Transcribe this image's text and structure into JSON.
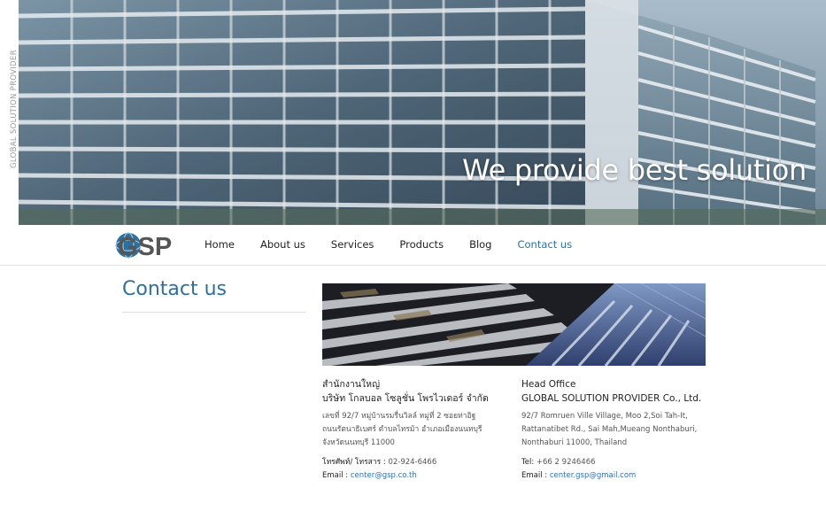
{
  "side_label": "GLOBAL SOLUTION PROVIDER",
  "hero": {
    "tagline": "We provide best solution"
  },
  "logo": {
    "text": "GSP"
  },
  "nav": {
    "items": [
      {
        "label": "Home"
      },
      {
        "label": "About us"
      },
      {
        "label": "Services"
      },
      {
        "label": "Products"
      },
      {
        "label": "Blog"
      },
      {
        "label": "Contact us",
        "active": true
      }
    ]
  },
  "page": {
    "title": "Contact us"
  },
  "thai_office": {
    "heading": "สำนักงานใหญ่",
    "company": "บริษัท โกลบอล โซลูชั่น โพรไวเดอร์ จำกัด",
    "address_line1": "เลขที่ 92/7 หมู่บ้านรมรื่นวิลล์ หมู่ที่ 2 ซอยท่าอิฐ",
    "address_line2": "ถนนรัตนาธิเบศร์ ตำบลไทรม้า อำเภอเมืองนนทบุรี",
    "address_line3": "จังหวัดนนทบุรี 11000",
    "phone_label": "โทรศัพท์/ โทรสาร :",
    "phone": "02-924-6466",
    "email_label": "Email :",
    "email": "center@gsp.co.th"
  },
  "english_office": {
    "heading": "Head Office",
    "company": "GLOBAL SOLUTION PROVIDER Co., Ltd.",
    "address_line1": "92/7 Romruen Ville Village, Moo 2,Soi Tah-It,",
    "address_line2": "Rattanatibet Rd., Sai Mah,Mueang Nonthaburi,",
    "address_line3": "Nonthaburi 11000, Thailand",
    "phone_label": "Tel:",
    "phone": "+66 2 9246466",
    "email_label": "Email :",
    "email": "center.gsp@gmail.com"
  },
  "colors": {
    "accent": "#2f6f9f",
    "link": "#2f6fb5"
  }
}
